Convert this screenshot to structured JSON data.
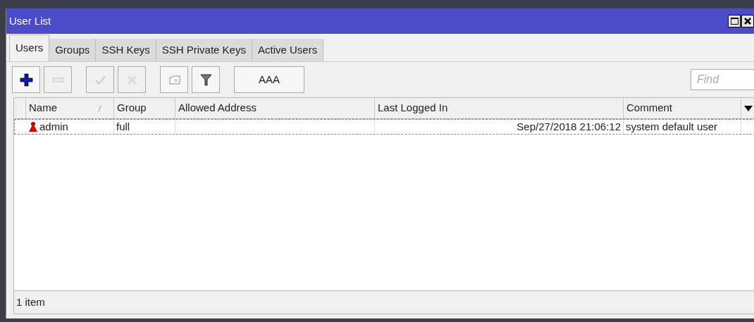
{
  "window": {
    "title": "User List"
  },
  "tabs": [
    {
      "label": "Users",
      "selected": true
    },
    {
      "label": "Groups",
      "selected": false
    },
    {
      "label": "SSH Keys",
      "selected": false
    },
    {
      "label": "SSH Private Keys",
      "selected": false
    },
    {
      "label": "Active Users",
      "selected": false
    }
  ],
  "toolbar": [
    {
      "kind": "add",
      "disabled": false
    },
    {
      "kind": "remove",
      "disabled": true
    },
    {
      "kind": "enable",
      "disabled": true
    },
    {
      "kind": "disable",
      "disabled": true
    },
    {
      "kind": "comment",
      "disabled": false
    },
    {
      "kind": "filter",
      "disabled": false
    },
    {
      "kind": "text",
      "label": "AAA",
      "disabled": false
    }
  ],
  "search": {
    "placeholder": "Find"
  },
  "table": {
    "columns": [
      {
        "label": "Name",
        "sorted": true
      },
      {
        "label": "Group",
        "sorted": false
      },
      {
        "label": "Allowed Address",
        "sorted": false
      },
      {
        "label": "Last Logged In",
        "sorted": false
      },
      {
        "label": "Comment",
        "sorted": false
      }
    ],
    "rows": [
      {
        "name": "admin",
        "group": "full",
        "allowed_address": "",
        "last_logged_in": "Sep/27/2018 21:06:12",
        "comment": "system default user",
        "selected": true
      }
    ]
  },
  "status_bar": "1 item"
}
